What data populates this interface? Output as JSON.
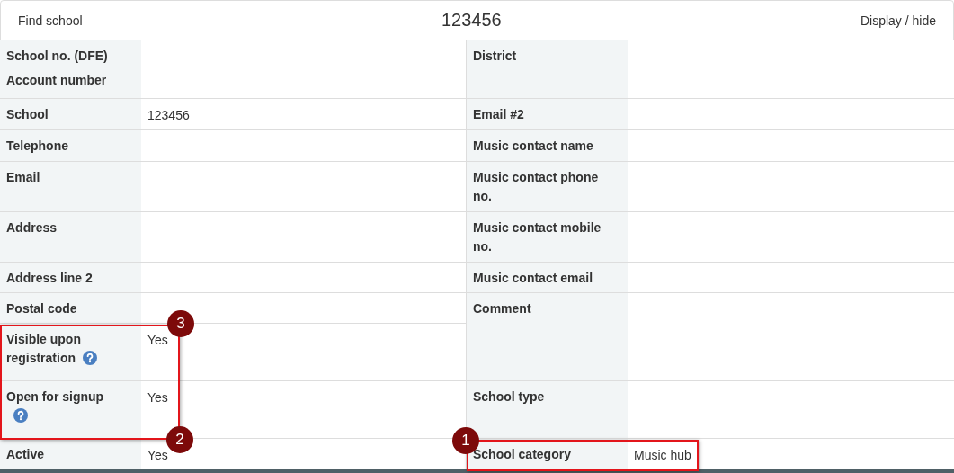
{
  "header": {
    "left_link": "Find school",
    "title": "123456",
    "right_link": "Display / hide"
  },
  "left_rows": [
    {
      "label": "School no. (DFE)",
      "sublabel": "Account number",
      "help": false
    },
    {
      "label": "School",
      "value": "123456",
      "help": false
    },
    {
      "label": "Telephone",
      "help": false
    },
    {
      "label": "Email",
      "help": false
    },
    {
      "label": "Address",
      "help": false
    },
    {
      "label": "Address line 2",
      "help": false
    },
    {
      "label": "Postal code",
      "help": false
    },
    {
      "label": "Visible upon registration",
      "value": "Yes",
      "help": true
    },
    {
      "label": "Open for signup",
      "value": "Yes",
      "help": true
    },
    {
      "label": "Active",
      "value": "Yes",
      "help": false
    }
  ],
  "right_rows": [
    {
      "label": "District"
    },
    {
      "label": "Email #2"
    },
    {
      "label": "Music contact name"
    },
    {
      "label": "Music contact phone no."
    },
    {
      "label": "Music contact mobile no."
    },
    {
      "label": "Music contact email"
    },
    {
      "label": "Comment"
    },
    {
      "label": "School type"
    },
    {
      "label": "School category",
      "value": "Music hub"
    }
  ],
  "callouts": [
    {
      "number": "1"
    },
    {
      "number": "2"
    },
    {
      "number": "3"
    }
  ]
}
